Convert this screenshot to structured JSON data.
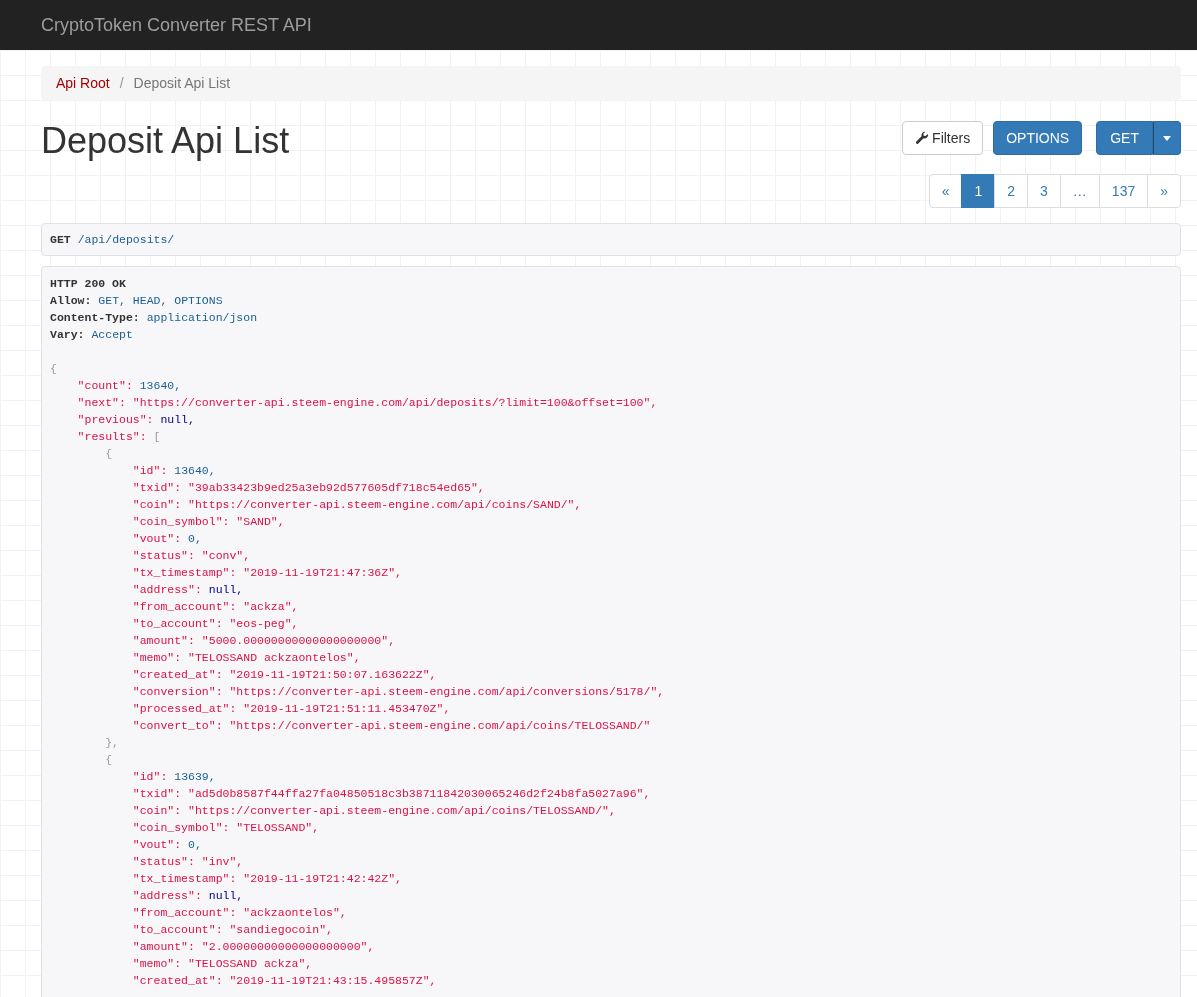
{
  "navbar": {
    "brand": "CryptoToken Converter REST API"
  },
  "breadcrumb": [
    {
      "label": "Api Root",
      "link": true
    },
    {
      "label": "/",
      "link": false
    },
    {
      "label": "Deposit Api List",
      "link": false
    }
  ],
  "page_title": "Deposit Api List",
  "buttons": {
    "filters": "Filters",
    "options": "OPTIONS",
    "get": "GET"
  },
  "pagination": [
    {
      "label": "«",
      "selected": false
    },
    {
      "label": "1",
      "selected": true
    },
    {
      "label": "2",
      "selected": false
    },
    {
      "label": "3",
      "selected": false
    },
    {
      "label": "…",
      "selected": false
    },
    {
      "label": "137",
      "selected": false
    },
    {
      "label": "»",
      "selected": false
    }
  ],
  "request": {
    "method": "GET",
    "path": "/api/deposits/"
  },
  "response": {
    "status": "HTTP 200 OK",
    "headers": [
      {
        "name": "Allow:",
        "value": "GET, HEAD, OPTIONS"
      },
      {
        "name": "Content-Type:",
        "value": "application/json"
      },
      {
        "name": "Vary:",
        "value": "Accept"
      }
    ],
    "body": {
      "open": "{",
      "fields": [
        {
          "key": "\"count\":",
          "value": "13640,",
          "kind": "number"
        },
        {
          "key": "\"next\":",
          "value": "\"https://converter-api.steem-engine.com/api/deposits/?limit=100&offset=100\",",
          "kind": "string"
        },
        {
          "key": "\"previous\":",
          "value": "null,",
          "kind": "null"
        },
        {
          "key": "\"results\":",
          "open": "[",
          "items": [
            {
              "open": "{",
              "fields": [
                {
                  "key": "\"id\":",
                  "value": "13640,",
                  "kind": "number"
                },
                {
                  "key": "\"txid\":",
                  "value": "\"39ab33423b9ed25a3eb92d577605df718c54ed65\",",
                  "kind": "string"
                },
                {
                  "key": "\"coin\":",
                  "value": "\"https://converter-api.steem-engine.com/api/coins/SAND/\",",
                  "kind": "string"
                },
                {
                  "key": "\"coin_symbol\":",
                  "value": "\"SAND\",",
                  "kind": "string"
                },
                {
                  "key": "\"vout\":",
                  "value": "0,",
                  "kind": "number"
                },
                {
                  "key": "\"status\":",
                  "value": "\"conv\",",
                  "kind": "string"
                },
                {
                  "key": "\"tx_timestamp\":",
                  "value": "\"2019-11-19T21:47:36Z\",",
                  "kind": "string"
                },
                {
                  "key": "\"address\":",
                  "value": "null,",
                  "kind": "null"
                },
                {
                  "key": "\"from_account\":",
                  "value": "\"ackza\",",
                  "kind": "string"
                },
                {
                  "key": "\"to_account\":",
                  "value": "\"eos-peg\",",
                  "kind": "string"
                },
                {
                  "key": "\"amount\":",
                  "value": "\"5000.00000000000000000000\",",
                  "kind": "string"
                },
                {
                  "key": "\"memo\":",
                  "value": "\"TELOSSAND ackzaontelos\",",
                  "kind": "string"
                },
                {
                  "key": "\"created_at\":",
                  "value": "\"2019-11-19T21:50:07.163622Z\",",
                  "kind": "string"
                },
                {
                  "key": "\"conversion\":",
                  "value": "\"https://converter-api.steem-engine.com/api/conversions/5178/\",",
                  "kind": "string"
                },
                {
                  "key": "\"processed_at\":",
                  "value": "\"2019-11-19T21:51:11.453470Z\",",
                  "kind": "string"
                },
                {
                  "key": "\"convert_to\":",
                  "value": "\"https://converter-api.steem-engine.com/api/coins/TELOSSAND/\"",
                  "kind": "string"
                }
              ],
              "close": "},"
            },
            {
              "open": "{",
              "fields": [
                {
                  "key": "\"id\":",
                  "value": "13639,",
                  "kind": "number"
                },
                {
                  "key": "\"txid\":",
                  "value": "\"ad5d0b8587f44ffa27fa04850518c3b38711842030065246d2f24b8fa5027a96\",",
                  "kind": "string"
                },
                {
                  "key": "\"coin\":",
                  "value": "\"https://converter-api.steem-engine.com/api/coins/TELOSSAND/\",",
                  "kind": "string"
                },
                {
                  "key": "\"coin_symbol\":",
                  "value": "\"TELOSSAND\",",
                  "kind": "string"
                },
                {
                  "key": "\"vout\":",
                  "value": "0,",
                  "kind": "number"
                },
                {
                  "key": "\"status\":",
                  "value": "\"inv\",",
                  "kind": "string"
                },
                {
                  "key": "\"tx_timestamp\":",
                  "value": "\"2019-11-19T21:42:42Z\",",
                  "kind": "string"
                },
                {
                  "key": "\"address\":",
                  "value": "null,",
                  "kind": "null"
                },
                {
                  "key": "\"from_account\":",
                  "value": "\"ackzaontelos\",",
                  "kind": "string"
                },
                {
                  "key": "\"to_account\":",
                  "value": "\"sandiegocoin\",",
                  "kind": "string"
                },
                {
                  "key": "\"amount\":",
                  "value": "\"2.00000000000000000000\",",
                  "kind": "string"
                },
                {
                  "key": "\"memo\":",
                  "value": "\"TELOSSAND ackza\",",
                  "kind": "string"
                },
                {
                  "key": "\"created_at\":",
                  "value": "\"2019-11-19T21:43:15.495857Z\",",
                  "kind": "string"
                }
              ]
            }
          ]
        }
      ]
    }
  }
}
